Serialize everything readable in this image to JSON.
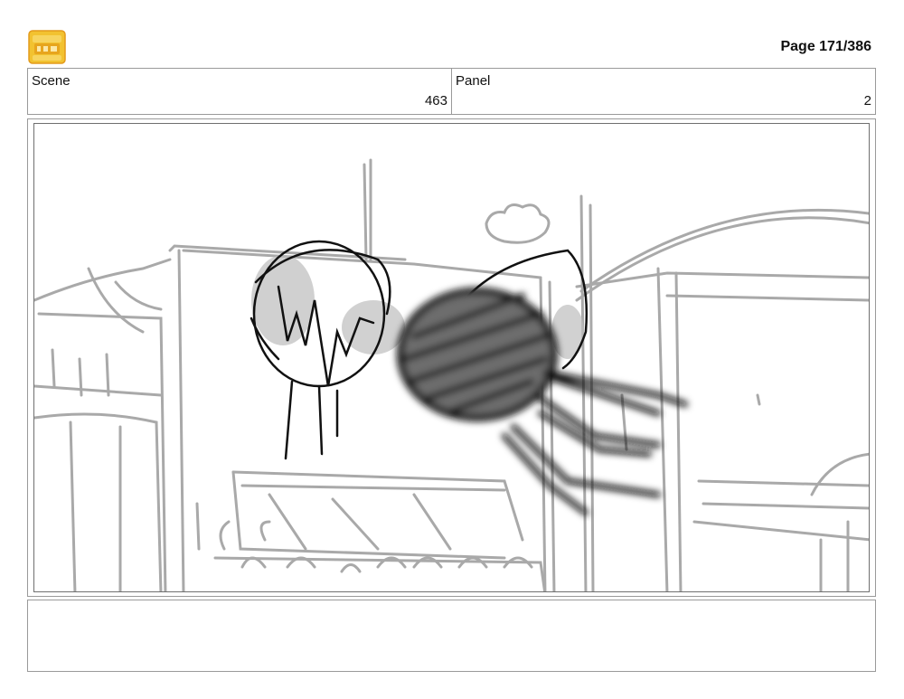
{
  "header": {
    "logo_name": "jedi-logo",
    "page_label": "Page 171/386"
  },
  "info": {
    "scene_label": "Scene",
    "scene_value": "463",
    "panel_label": "Panel",
    "panel_value": "2"
  },
  "notes": {
    "text": ""
  },
  "colors": {
    "logo_yellow": "#f2c230",
    "logo_orange": "#e39a1b",
    "sketch_gray": "#a9a9a9",
    "sketch_black": "#111111"
  }
}
